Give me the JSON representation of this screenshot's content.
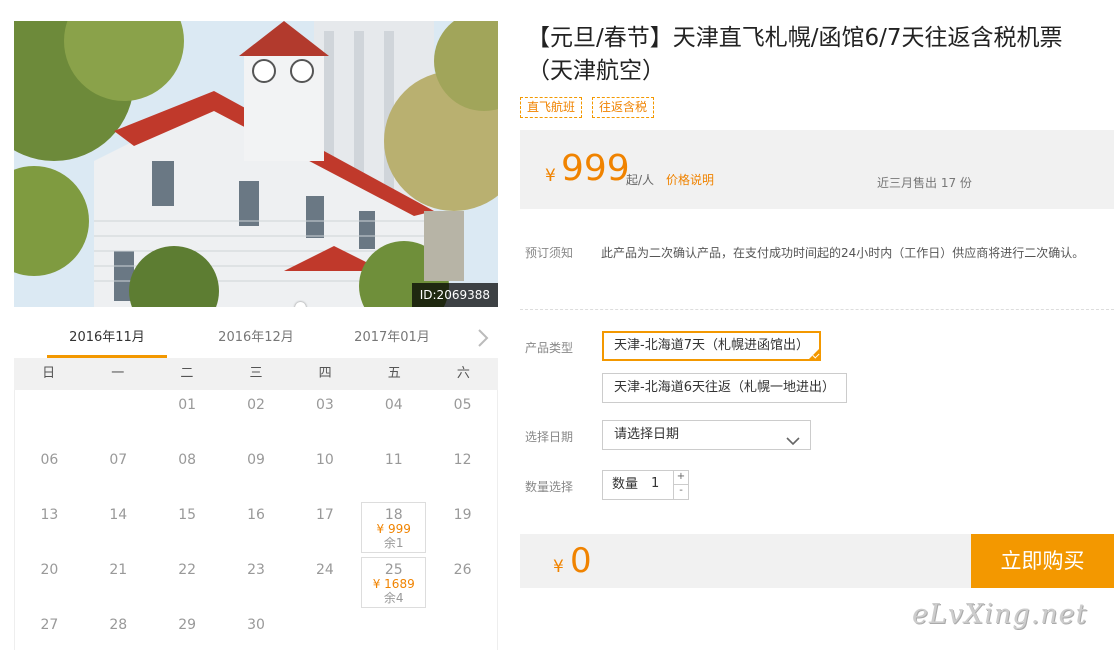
{
  "photo": {
    "id_label": "ID:2069388"
  },
  "calendar": {
    "tabs": [
      "2016年11月",
      "2016年12月",
      "2017年01月"
    ],
    "weekdays": [
      "日",
      "一",
      "二",
      "三",
      "四",
      "五",
      "六"
    ],
    "weeks": [
      [
        {
          "d": ""
        },
        {
          "d": ""
        },
        {
          "d": "01"
        },
        {
          "d": "02"
        },
        {
          "d": "03"
        },
        {
          "d": "04"
        },
        {
          "d": "05"
        }
      ],
      [
        {
          "d": "06"
        },
        {
          "d": "07"
        },
        {
          "d": "08"
        },
        {
          "d": "09"
        },
        {
          "d": "10"
        },
        {
          "d": "11"
        },
        {
          "d": "12"
        }
      ],
      [
        {
          "d": "13"
        },
        {
          "d": "14"
        },
        {
          "d": "15"
        },
        {
          "d": "16"
        },
        {
          "d": "17"
        },
        {
          "d": "18",
          "price": "¥ 999",
          "stock": "余1"
        },
        {
          "d": "19"
        }
      ],
      [
        {
          "d": "20"
        },
        {
          "d": "21"
        },
        {
          "d": "22"
        },
        {
          "d": "23"
        },
        {
          "d": "24"
        },
        {
          "d": "25",
          "price": "¥ 1689",
          "stock": "余4"
        },
        {
          "d": "26"
        }
      ],
      [
        {
          "d": "27"
        },
        {
          "d": "28"
        },
        {
          "d": "29"
        },
        {
          "d": "30"
        },
        {
          "d": ""
        },
        {
          "d": ""
        },
        {
          "d": ""
        }
      ]
    ]
  },
  "product": {
    "title": "【元旦/春节】天津直飞札幌/函馆6/7天往返含税机票（天津航空）",
    "tags": [
      "直飞航班",
      "往返含税"
    ]
  },
  "pricing": {
    "currency": "¥",
    "price": "999",
    "unit": "起/人",
    "note": "价格说明",
    "sold": "近三月售出 17 份"
  },
  "notice": {
    "label": "预订须知",
    "text": "此产品为二次确认产品，在支付成功时间起的24小时内（工作日）供应商将进行二次确认。"
  },
  "options": {
    "type_label": "产品类型",
    "types": [
      "天津-北海道7天（札幌进函馆出）",
      "天津-北海道6天往返（札幌一地进出）"
    ],
    "date_label": "选择日期",
    "date_placeholder": "请选择日期",
    "qty_label": "数量选择",
    "qty_inner_label": "数量",
    "qty_value": "1",
    "qty_up": "+",
    "qty_down": "-"
  },
  "total": {
    "currency": "¥",
    "value": "0",
    "buy_label": "立即购买"
  },
  "watermark": "eLvXing.net",
  "colors": {
    "accent": "#f39800",
    "price": "#f08300",
    "panel": "#f1f1f1"
  }
}
